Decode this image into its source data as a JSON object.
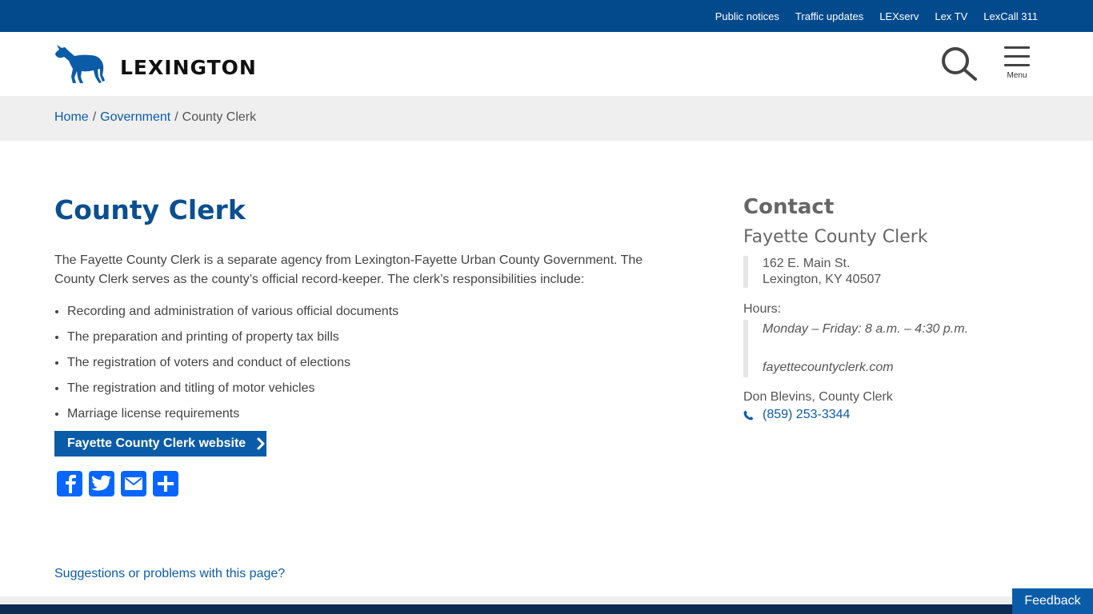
{
  "topbar": {
    "links": [
      "Public notices",
      "Traffic updates",
      "LEXserv",
      "Lex TV",
      "LexCall 311"
    ]
  },
  "header": {
    "logo_text": "LEXINGTON",
    "menu_label": "Menu"
  },
  "breadcrumb": {
    "home": "Home",
    "government": "Government",
    "current": "County Clerk",
    "separator": "/"
  },
  "main": {
    "title": "County Clerk",
    "intro": "The Fayette County Clerk is a separate agency from Lexington-Fayette Urban County Government. The County Clerk serves as the county’s official record-keeper. The clerk’s responsibilities include:",
    "responsibilities": [
      "Recording and administration of various official documents",
      "The preparation and printing of property tax bills",
      "The registration of voters and conduct of elections",
      "The registration and titling of motor vehicles",
      "Marriage license requirements"
    ],
    "cta_label": "Fayette County Clerk website",
    "suggest_link": "Suggestions or problems with this page?"
  },
  "share": {
    "icons": [
      "facebook-icon",
      "twitter-icon",
      "email-icon",
      "share-icon"
    ]
  },
  "contact": {
    "title": "Contact",
    "org": "Fayette County Clerk",
    "address_line1": "162 E. Main St.",
    "address_line2": "Lexington, KY  40507",
    "hours_label": "Hours:",
    "hours": "Monday – Friday: 8 a.m. – 4:30 p.m.",
    "website": "fayettecountyclerk.com",
    "person": "Don Blevins, County Clerk",
    "phone": "(859) 253-3344"
  },
  "feedback_label": "Feedback",
  "colors": {
    "topbar": "#034a8d",
    "link": "#0b5ca8",
    "title": "#0b4f8f",
    "share": "#0866ff",
    "footer": "#0c2b52"
  }
}
